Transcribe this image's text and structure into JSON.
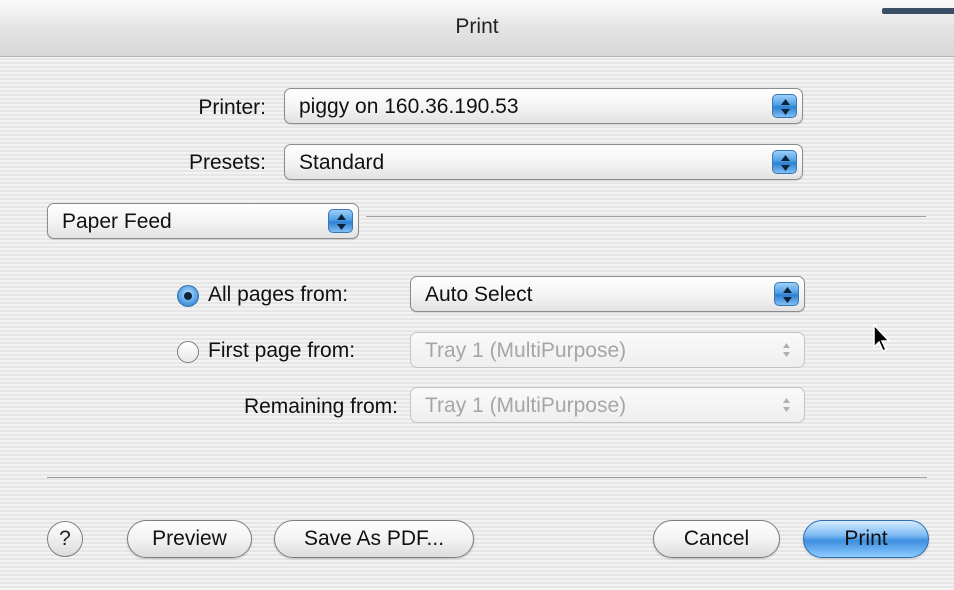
{
  "window": {
    "title": "Print"
  },
  "printer": {
    "label": "Printer:",
    "value": "piggy on 160.36.190.53"
  },
  "presets": {
    "label": "Presets:",
    "value": "Standard"
  },
  "panel": {
    "value": "Paper Feed"
  },
  "paper_feed": {
    "all_pages": {
      "label": "All pages from:",
      "selected": true,
      "value": "Auto Select",
      "enabled": true
    },
    "first_page": {
      "label": "First page from:",
      "selected": false,
      "value": "Tray 1 (MultiPurpose)",
      "enabled": false
    },
    "remaining": {
      "label": "Remaining from:",
      "value": "Tray 1 (MultiPurpose)",
      "enabled": false
    }
  },
  "buttons": {
    "help": "?",
    "preview": "Preview",
    "save_pdf": "Save As PDF...",
    "cancel": "Cancel",
    "print": "Print"
  },
  "colors": {
    "accent_blue": "#4f9fe5",
    "disabled_text": "#a6a6a6"
  },
  "icons": {
    "popup_arrows": "up-down-arrows-icon",
    "cursor": "mouse-pointer-icon"
  }
}
